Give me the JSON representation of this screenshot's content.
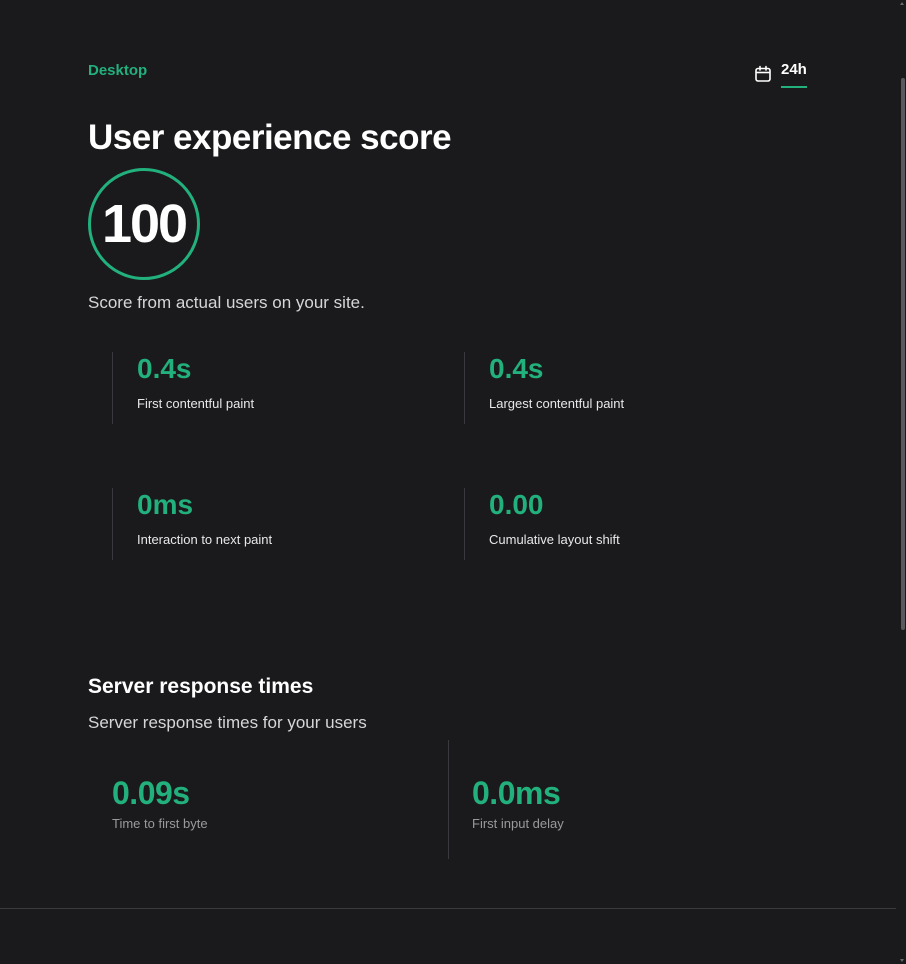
{
  "header": {
    "device": "Desktop",
    "time_range": "24h"
  },
  "ux": {
    "title": "User experience score",
    "score": "100",
    "description": "Score from actual users on your site.",
    "metrics": [
      {
        "value": "0.4s",
        "label": "First contentful paint"
      },
      {
        "value": "0.4s",
        "label": "Largest contentful paint"
      },
      {
        "value": "0ms",
        "label": "Interaction to next paint"
      },
      {
        "value": "0.00",
        "label": "Cumulative layout shift"
      }
    ]
  },
  "server": {
    "title": "Server response times",
    "description": "Server response times for your users",
    "metrics": [
      {
        "value": "0.09s",
        "label": "Time to first byte"
      },
      {
        "value": "0.0ms",
        "label": "First input delay"
      }
    ]
  },
  "colors": {
    "accent": "#22b07d",
    "background": "#1a1a1c",
    "divider": "#3a3a3e"
  },
  "icons": {
    "range": "calendar-icon"
  }
}
